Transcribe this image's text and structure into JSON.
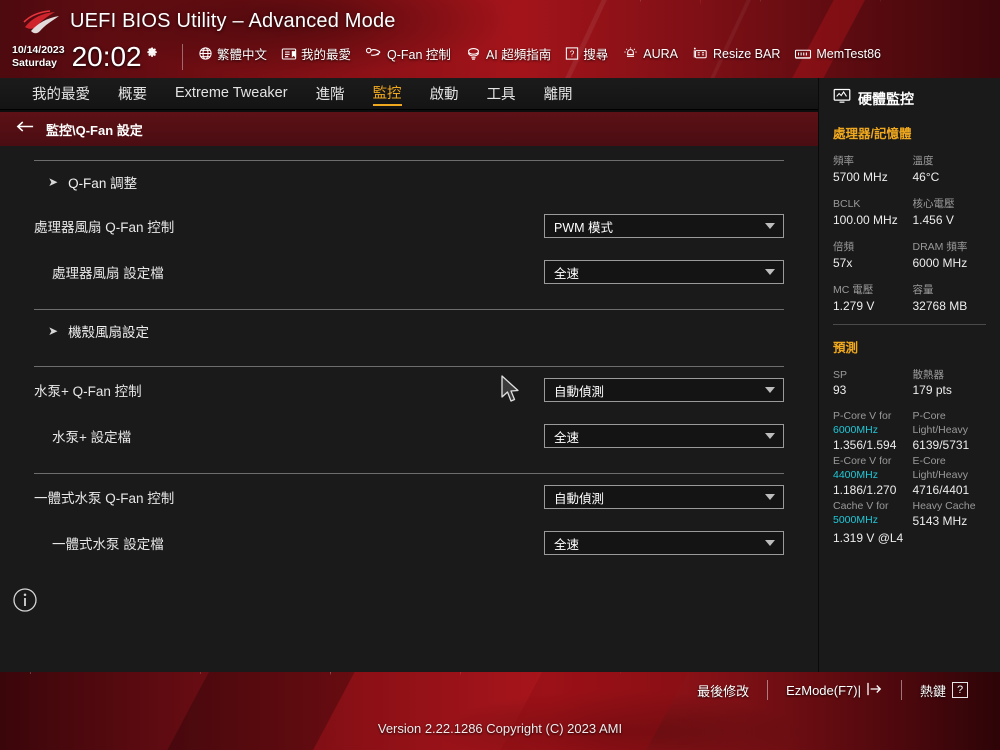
{
  "header": {
    "title": "UEFI BIOS Utility – Advanced Mode",
    "logo_icon": "rog-logo-icon",
    "date": "10/14/2023",
    "day": "Saturday",
    "time": "20:02",
    "gear_icon": "gear-icon",
    "toolbar": [
      {
        "label": "繁體中文",
        "icon": "globe-icon"
      },
      {
        "label": "我的最愛",
        "icon": "favorites-icon"
      },
      {
        "label": "Q-Fan 控制",
        "icon": "fan-icon"
      },
      {
        "label": "AI 超頻指南",
        "icon": "ai-oc-icon"
      },
      {
        "label": "搜尋",
        "icon": "search-icon"
      },
      {
        "label": "AURA",
        "icon": "aura-icon"
      },
      {
        "label": "Resize BAR",
        "icon": "resize-bar-icon"
      },
      {
        "label": "MemTest86",
        "icon": "memtest-icon"
      }
    ]
  },
  "nav": {
    "items": [
      {
        "label": "我的最愛",
        "active": false
      },
      {
        "label": "概要",
        "active": false
      },
      {
        "label": "Extreme Tweaker",
        "active": false
      },
      {
        "label": "進階",
        "active": false
      },
      {
        "label": "監控",
        "active": true
      },
      {
        "label": "啟動",
        "active": false
      },
      {
        "label": "工具",
        "active": false
      },
      {
        "label": "離開",
        "active": false
      }
    ],
    "active_color": "#f0a81e"
  },
  "breadcrumb": {
    "back_icon": "back-arrow-icon",
    "path": "監控\\Q-Fan 設定"
  },
  "main": {
    "sections": [
      {
        "arrow_icon": "expand-arrow-icon",
        "title": "Q-Fan 調整"
      },
      {
        "arrow_icon": "expand-arrow-icon",
        "title": "機殼風扇設定"
      }
    ],
    "rows": [
      {
        "label": "處理器風扇 Q-Fan 控制",
        "value": "PWM 模式",
        "indent": false
      },
      {
        "label": "處理器風扇 設定檔",
        "value": "全速",
        "indent": true
      },
      {
        "label": "水泵+ Q-Fan 控制",
        "value": "自動偵測",
        "indent": false
      },
      {
        "label": "水泵+ 設定檔",
        "value": "全速",
        "indent": true
      },
      {
        "label": "一體式水泵 Q-Fan 控制",
        "value": "自動偵測",
        "indent": false
      },
      {
        "label": "一體式水泵 設定檔",
        "value": "全速",
        "indent": true
      }
    ],
    "info_icon": "info-circle-icon"
  },
  "sidebar": {
    "monitor_icon": "monitor-icon",
    "title": "硬體監控",
    "cpu_section": {
      "heading": "處理器/記憶體",
      "pairs": [
        {
          "k1": "頻率",
          "v1": "5700 MHz",
          "k2": "溫度",
          "v2": "46°C"
        },
        {
          "k1": "BCLK",
          "v1": "100.00 MHz",
          "k2": "核心電壓",
          "v2": "1.456 V"
        },
        {
          "k1": "倍頻",
          "v1": "57x",
          "k2": "DRAM 頻率",
          "v2": "6000 MHz"
        },
        {
          "k1": "MC 電壓",
          "v1": "1.279 V",
          "k2": "容量",
          "v2": "32768 MB"
        }
      ]
    },
    "prediction": {
      "heading": "預測",
      "sp_key": "SP",
      "sp_value": "93",
      "cooler_key": "散熱器",
      "cooler_value": "179 pts",
      "pcore_key_a": "P-Core V for",
      "pcore_key_b": "6000MHz",
      "pcore_value": "1.356/1.594",
      "pcore_lh_a": "P-Core",
      "pcore_lh_b": "Light/Heavy",
      "pcore_lh_value": "6139/5731",
      "ecore_key_a": "E-Core V for",
      "ecore_key_b": "4400MHz",
      "ecore_value": "1.186/1.270",
      "ecore_lh_a": "E-Core",
      "ecore_lh_b": "Light/Heavy",
      "ecore_lh_value": "4716/4401",
      "cache_key_a": "Cache V for",
      "cache_key_b": "5000MHz",
      "cache_value": "1.319 V @L4",
      "heavy_cache_key": "Heavy Cache",
      "heavy_cache_value": "5143 MHz",
      "highlight_color": "#1fc8d8"
    }
  },
  "footer": {
    "last_modified": "最後修改",
    "ezmode": "EzMode(F7)|",
    "ezmode_icon": "exit-arrow-icon",
    "hotkeys": "熱鍵",
    "hotkey_symbol": "?",
    "version": "Version 2.22.1286 Copyright (C) 2023 AMI"
  },
  "cursor": {
    "icon": "mouse-pointer-icon"
  }
}
